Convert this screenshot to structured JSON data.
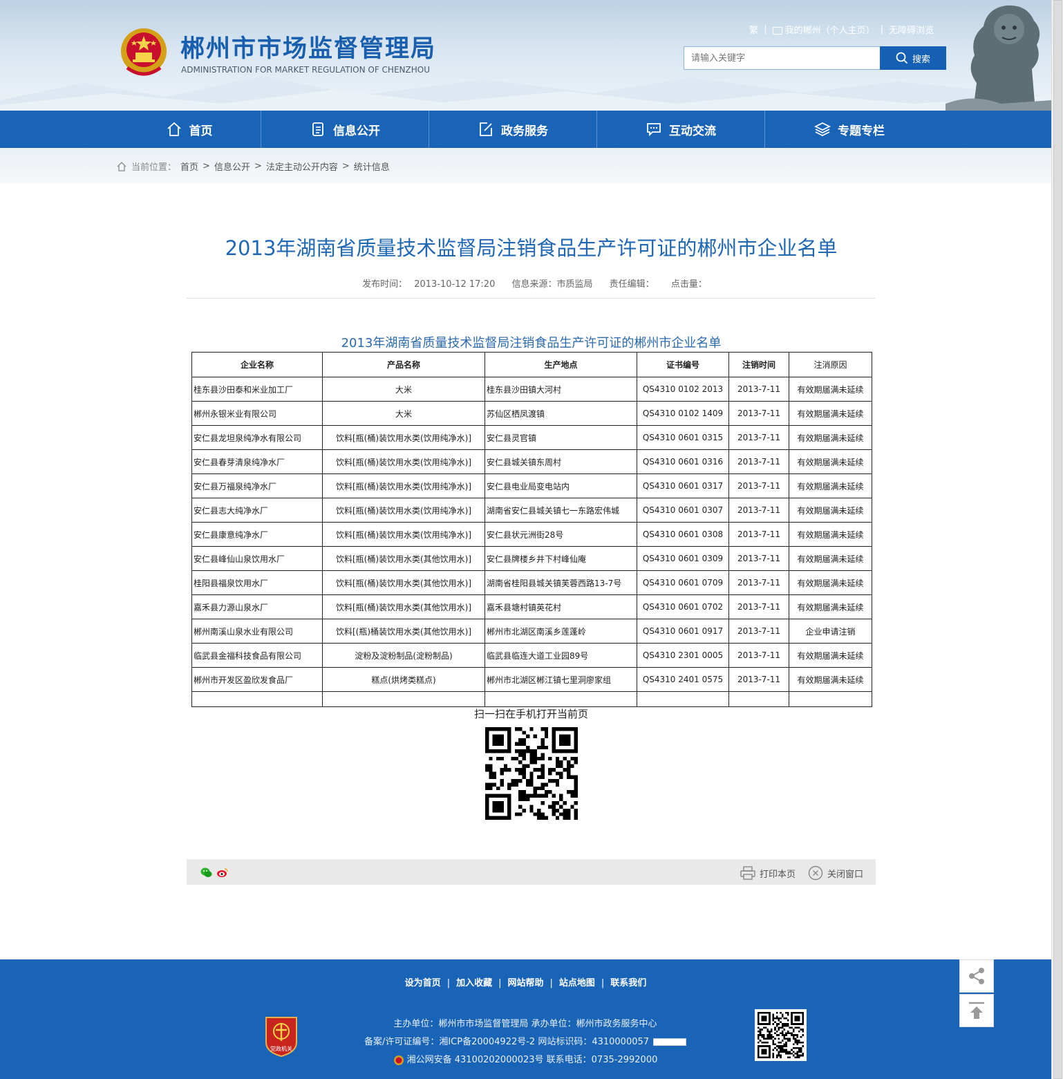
{
  "header": {
    "title": "郴州市市场监督管理局",
    "subtitle": "ADMINISTRATION FOR MARKET REGULATION OF CHENZHOU",
    "top_links": {
      "traditional": "繁",
      "my_chenzhou": "我的郴州（个人主页）",
      "accessible": "无障碍浏览"
    },
    "search": {
      "placeholder": "请输入关键字",
      "button": "搜索"
    }
  },
  "nav": [
    {
      "label": "首页",
      "icon": "home-icon"
    },
    {
      "label": "信息公开",
      "icon": "document-icon"
    },
    {
      "label": "政务服务",
      "icon": "edit-icon"
    },
    {
      "label": "互动交流",
      "icon": "chat-icon"
    },
    {
      "label": "专题专栏",
      "icon": "layers-icon"
    }
  ],
  "breadcrumb": {
    "label": "当前位置：",
    "items": [
      "首页",
      "信息公开",
      "法定主动公开内容",
      "统计信息"
    ]
  },
  "article": {
    "title": "2013年湖南省质量技术监督局注销食品生产许可证的郴州市企业名单",
    "publish_label": "发布时间：",
    "publish_time": "2013-10-12 17:20",
    "source_label": "信息来源：",
    "source": "市质监局",
    "editor_label": "责任编辑：",
    "clicks_label": "点击量：",
    "table_title": "2013年湖南省质量技术监督局注销食品生产许可证的郴州市企业名单",
    "table": {
      "headers": [
        "企业名称",
        "产品名称",
        "生产地点",
        "证书编号",
        "注销时间",
        "注消原因"
      ],
      "rows": [
        [
          "桂东县沙田泰和米业加工厂",
          "大米",
          "桂东县沙田镇大河村",
          "QS4310 0102 2013",
          "2013-7-11",
          "有效期届满未延续"
        ],
        [
          "郴州永银米业有限公司",
          "大米",
          "苏仙区栖凤渡镇",
          "QS4310 0102 1409",
          "2013-7-11",
          "有效期届满未延续"
        ],
        [
          "安仁县龙坦泉纯净水有限公司",
          "饮料[瓶(桶)装饮用水类(饮用纯净水)]",
          "安仁县灵官镇",
          "QS4310 0601 0315",
          "2013-7-11",
          "有效期届满未延续"
        ],
        [
          "安仁县春芽清泉纯净水厂",
          "饮料[瓶(桶)装饮用水类(饮用纯净水)]",
          "安仁县城关镇东周村",
          "QS4310 0601 0316",
          "2013-7-11",
          "有效期届满未延续"
        ],
        [
          "安仁县万福泉纯净水厂",
          "饮料[瓶(桶)装饮用水类(饮用纯净水)]",
          "安仁县电业局变电站内",
          "QS4310 0601 0317",
          "2013-7-11",
          "有效期届满未延续"
        ],
        [
          "安仁县志大纯净水厂",
          "饮料[瓶(桶)装饮用水类(饮用纯净水)]",
          "湖南省安仁县城关镇七一东路宏伟城",
          "QS4310 0601 0307",
          "2013-7-11",
          "有效期届满未延续"
        ],
        [
          "安仁县康意纯净水厂",
          "饮料[瓶(桶)装饮用水类(饮用纯净水)]",
          "安仁县状元洲街28号",
          "QS4310 0601 0308",
          "2013-7-11",
          "有效期届满未延续"
        ],
        [
          "安仁县峰仙山泉饮用水厂",
          "饮料[瓶(桶)装饮用水类(其他饮用水)]",
          "安仁县牌楼乡井下村峰仙庵",
          "QS4310 0601 0309",
          "2013-7-11",
          "有效期届满未延续"
        ],
        [
          "桂阳县福泉饮用水厂",
          "饮料[瓶(桶)装饮用水类(其他饮用水)]",
          "湖南省桂阳县城关镇芙蓉西路13-7号",
          "QS4310 0601 0709",
          "2013-7-11",
          "有效期届满未延续"
        ],
        [
          "嘉禾县力源山泉水厂",
          "饮料[瓶(桶)装饮用水类(其他饮用水)]",
          "嘉禾县塘村镇英花村",
          "QS4310 0601 0702",
          "2013-7-11",
          "有效期届满未延续"
        ],
        [
          "郴州南溪山泉水业有限公司",
          "饮料[(瓶)桶装饮用水类(其他饮用水)]",
          "郴州市北湖区南溪乡莲蓬岭",
          "QS4310 0601 0917",
          "2013-7-11",
          "企业申请注销"
        ],
        [
          "临武县金福科技食品有限公司",
          "淀粉及淀粉制品(淀粉制品)",
          "临武县临连大道工业园89号",
          "QS4310 2301 0005",
          "2013-7-11",
          "有效期届满未延续"
        ],
        [
          "郴州市开发区盈欣发食品厂",
          "糕点(烘烤类糕点)",
          "郴州市北湖区郴江镇七里洞廖家组",
          "QS4310 2401 0575",
          "2013-7-11",
          "有效期届满未延续"
        ]
      ]
    },
    "qr_label": "扫一扫在手机打开当前页",
    "print": "打印本页",
    "close": "关闭窗口"
  },
  "footer": {
    "links": [
      "设为首页",
      "加入收藏",
      "网站帮助",
      "站点地图",
      "联系我们"
    ],
    "line1": "主办单位：郴州市市场监督管理局   承办单位：郴州市政务服务中心",
    "line2": "备案/许可证编号：湘ICP备20004922号-2   网站标识码：4310000057",
    "line3": "湘公网安备 43100202000023号   联系电话：0735-2992000",
    "badge_text": "党政机关"
  },
  "colors": {
    "brand_blue": "#1a64b8",
    "title_blue": "#2068b4"
  }
}
